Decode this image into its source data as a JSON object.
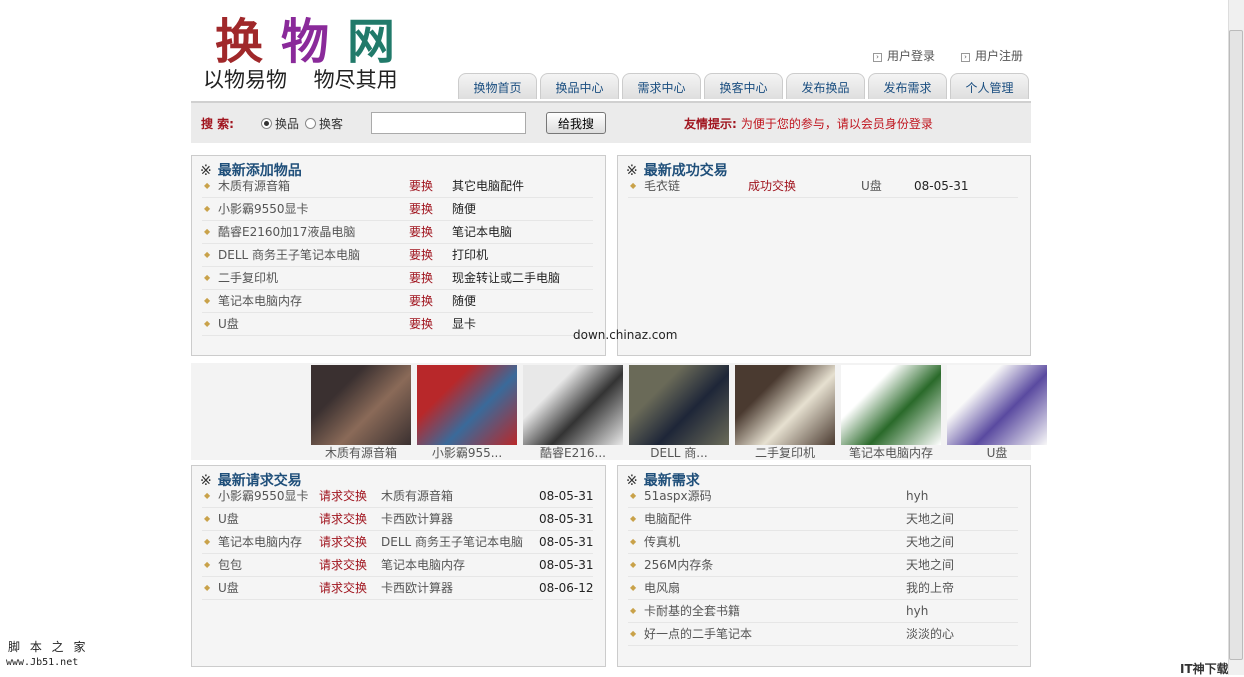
{
  "logo": {
    "chars": [
      "换",
      "物",
      "网"
    ],
    "colors": [
      "#a0282a",
      "#8a2a9a",
      "#217a6a"
    ]
  },
  "slogan": "以物易物 物尽其用",
  "toplinks": [
    "用户登录",
    "用户注册"
  ],
  "nav": [
    "换物首页",
    "换品中心",
    "需求中心",
    "换客中心",
    "发布换品",
    "发布需求",
    "个人管理"
  ],
  "search": {
    "label": "搜 索:",
    "options": [
      "换品",
      "换客"
    ],
    "selected": "换品",
    "value": "",
    "button": "给我搜",
    "tip_label": "友情提示:",
    "tip_text": "为便于您的参与，请以会员身份登录"
  },
  "watermark": "down.chinaz.com",
  "latest_items": {
    "title": "最新添加物品",
    "rows": [
      {
        "name": "木质有源音箱",
        "tag": "要换",
        "want": "其它电脑配件"
      },
      {
        "name": "小影霸9550显卡",
        "tag": "要换",
        "want": "随便"
      },
      {
        "name": "酷睿E2160加17液晶电脑",
        "tag": "要换",
        "want": "笔记本电脑"
      },
      {
        "name": "DELL 商务王子笔记本电脑",
        "tag": "要换",
        "want": "打印机"
      },
      {
        "name": "二手复印机",
        "tag": "要换",
        "want": "现金转让或二手电脑"
      },
      {
        "name": "笔记本电脑内存",
        "tag": "要换",
        "want": "随便"
      },
      {
        "name": "U盘",
        "tag": "要换",
        "want": "显卡"
      }
    ]
  },
  "success": {
    "title": "最新成功交易",
    "rows": [
      {
        "name": "毛衣链",
        "status": "成功交换",
        "item": "U盘",
        "date": "08-05-31"
      }
    ]
  },
  "gallery": [
    {
      "caption": "木质有源音箱",
      "colors": [
        "#3a3030",
        "#8a6a58"
      ]
    },
    {
      "caption": "小影霸955...",
      "colors": [
        "#b8282a",
        "#3a6a9a"
      ]
    },
    {
      "caption": "酷睿E216...",
      "colors": [
        "#e8e8e8",
        "#333"
      ]
    },
    {
      "caption": "DELL 商...",
      "colors": [
        "#6a6a58",
        "#1e2638"
      ]
    },
    {
      "caption": "二手复印机",
      "colors": [
        "#4a3a30",
        "#e6e0d0"
      ]
    },
    {
      "caption": "笔记本电脑内存",
      "colors": [
        "#ffffff",
        "#2a6a2a"
      ]
    },
    {
      "caption": "U盘",
      "colors": [
        "#f8f8f8",
        "#5a4aa0"
      ]
    }
  ],
  "requests": {
    "title": "最新请求交易",
    "rows": [
      {
        "name": "小影霸9550显卡",
        "tag": "请求交换",
        "item": "木质有源音箱",
        "date": "08-05-31"
      },
      {
        "name": "U盘",
        "tag": "请求交换",
        "item": "卡西欧计算器",
        "date": "08-05-31"
      },
      {
        "name": "笔记本电脑内存",
        "tag": "请求交换",
        "item": "DELL 商务王子笔记本电脑",
        "date": "08-05-31"
      },
      {
        "name": "包包",
        "tag": "请求交换",
        "item": "笔记本电脑内存",
        "date": "08-05-31"
      },
      {
        "name": "U盘",
        "tag": "请求交换",
        "item": "卡西欧计算器",
        "date": "08-06-12"
      }
    ]
  },
  "needs": {
    "title": "最新需求",
    "rows": [
      {
        "name": "51aspx源码",
        "user": "hyh"
      },
      {
        "name": "电脑配件",
        "user": "天地之间"
      },
      {
        "name": "传真机",
        "user": "天地之间"
      },
      {
        "name": "256M内存条",
        "user": "天地之间"
      },
      {
        "name": "电风扇",
        "user": "我的上帝"
      },
      {
        "name": "卡耐基的全套书籍",
        "user": "hyh"
      },
      {
        "name": "好一点的二手笔记本",
        "user": "淡淡的心"
      }
    ]
  },
  "footer_left": {
    "line1": "脚 本 之 家",
    "line2": "www.Jb51.net"
  },
  "footer_right": "IT神下载网"
}
